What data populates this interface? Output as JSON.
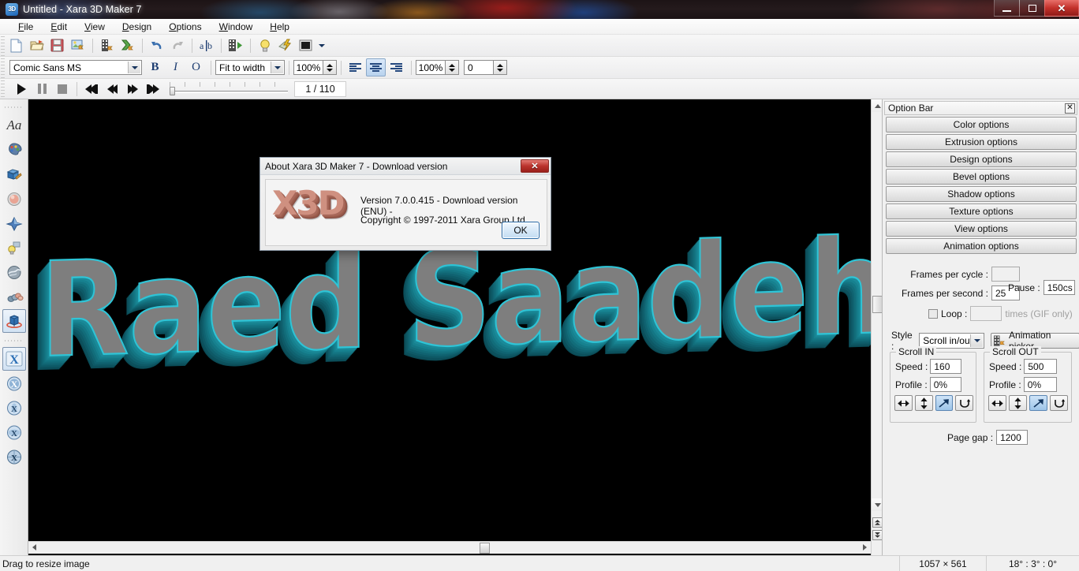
{
  "window": {
    "title": "Untitled - Xara 3D Maker 7",
    "app_icon": "3D",
    "minimize": "minimize-icon",
    "maximize": "restore-icon",
    "close": "close-icon"
  },
  "menu": [
    {
      "label": "File",
      "accel": "F"
    },
    {
      "label": "Edit",
      "accel": "E"
    },
    {
      "label": "View",
      "accel": "V"
    },
    {
      "label": "Design",
      "accel": "D"
    },
    {
      "label": "Options",
      "accel": "O"
    },
    {
      "label": "Window",
      "accel": "W"
    },
    {
      "label": "Help",
      "accel": "H"
    }
  ],
  "toolbar_main": {
    "icons": [
      "new-document-icon",
      "open-folder-icon",
      "save-disk-icon",
      "export-image-icon",
      "export-animation-icon",
      "export-flash-icon",
      "undo-icon",
      "redo-icon",
      "edit-text-icon",
      "preview-animation-icon",
      "light-bulb-icon",
      "lightning-icon",
      "background-color-icon",
      "chevron-down-icon"
    ]
  },
  "toolbar_format": {
    "font_name": "Comic Sans MS",
    "bold_label": "B",
    "italic_label": "I",
    "outline_label": "O",
    "view_mode": "Fit to width",
    "zoom_value": "100%",
    "track_value": "100%",
    "rotate_value": "0",
    "align_left": "align-left-icon",
    "align_center": "align-center-icon",
    "align_right": "align-right-icon"
  },
  "toolbar_playback": {
    "play": "play-icon",
    "pause": "pause-icon",
    "stop": "stop-icon",
    "first": "first-frame-icon",
    "prev": "previous-frame-icon",
    "next": "next-frame-icon",
    "last": "last-frame-icon",
    "frame_counter": "1 / 110"
  },
  "left_rail": {
    "tools": [
      {
        "name": "text-tool",
        "glyph": "Aa",
        "selected": false
      },
      {
        "name": "color-palette-tool",
        "glyph": "",
        "selected": false
      },
      {
        "name": "extrude-tool",
        "glyph": "",
        "selected": false
      },
      {
        "name": "bevel-tool",
        "glyph": "",
        "selected": false
      },
      {
        "name": "shadow-tool",
        "glyph": "",
        "selected": false
      },
      {
        "name": "lighting-tool",
        "glyph": "",
        "selected": false
      },
      {
        "name": "texture-tool",
        "glyph": "",
        "selected": false
      },
      {
        "name": "group-tool",
        "glyph": "",
        "selected": false
      },
      {
        "name": "rotate-object-tool",
        "glyph": "",
        "selected": true
      },
      {
        "name": "animation-x-tool",
        "glyph": "X",
        "selected": true
      },
      {
        "name": "animation-rotate-x-tool",
        "glyph": "X",
        "selected": false
      },
      {
        "name": "animation-swing-x-tool",
        "glyph": "X",
        "selected": false
      },
      {
        "name": "animation-flip-x-tool",
        "glyph": "X",
        "selected": false
      },
      {
        "name": "animation-tumble-x-tool",
        "glyph": "X",
        "selected": false
      }
    ]
  },
  "canvas": {
    "text": "Raed Saadeh",
    "face_color": "#7e7e7e",
    "extrude_color": "#18808f",
    "edge_color": "#2fc4d6",
    "background": "#000000"
  },
  "option_bar": {
    "title": "Option Bar",
    "close_label": "✕",
    "buttons": [
      "Color options",
      "Extrusion options",
      "Design options",
      "Bevel options",
      "Shadow options",
      "Texture options",
      "View options",
      "Animation options"
    ]
  },
  "animation": {
    "frames_per_cycle_label": "Frames per cycle :",
    "frames_per_cycle_value": "",
    "frames_per_second_label": "Frames per second :",
    "frames_per_second_value": "25",
    "pause_label": "Pause :",
    "pause_value": "150cs",
    "loop_label": "Loop :",
    "loop_value": "",
    "loop_suffix": "times (GIF only)",
    "style_label": "Style :",
    "style_value": "Scroll in/out",
    "picker_label": "Animation picker",
    "picker_icon": "animation-picker-icon",
    "scroll_in": {
      "title": "Scroll IN",
      "speed_label": "Speed :",
      "speed_value": "160",
      "profile_label": "Profile :",
      "profile_value": "0%",
      "buttons": [
        "horizontal-arrow-icon",
        "vertical-arrow-icon",
        "diagonal-arrow-icon",
        "rotate-arrow-icon"
      ],
      "active_index": 2
    },
    "scroll_out": {
      "title": "Scroll OUT",
      "speed_label": "Speed :",
      "speed_value": "500",
      "profile_label": "Profile :",
      "profile_value": "0%",
      "buttons": [
        "horizontal-arrow-icon",
        "vertical-arrow-icon",
        "diagonal-arrow-icon",
        "rotate-arrow-icon"
      ],
      "active_index": 2
    },
    "page_gap_label": "Page gap :",
    "page_gap_value": "1200"
  },
  "status": {
    "message": "Drag to resize image",
    "dimensions": "1057 × 561",
    "angles": "18° : 3° : 0°"
  },
  "dialog": {
    "title": "About Xara 3D Maker 7 - Download version",
    "close_label": "✕",
    "logo": "X3D",
    "line1": "Version 7.0.0.415 - Download version (ENU) -",
    "line2": "Copyright © 1997-2011 Xara Group Ltd.",
    "ok_label": "OK"
  }
}
